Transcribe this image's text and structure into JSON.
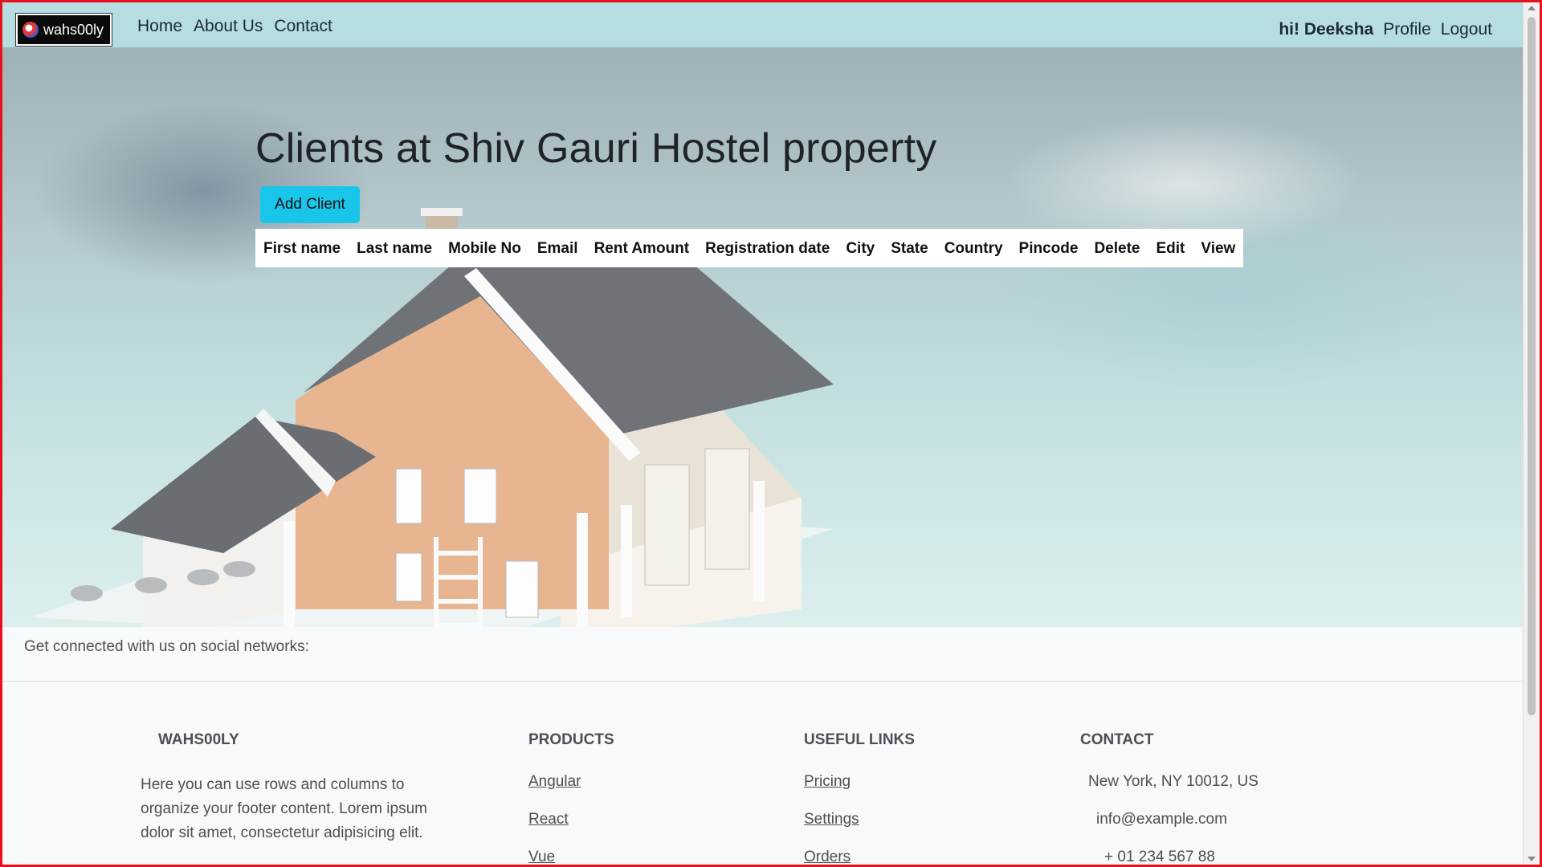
{
  "navbar": {
    "brand": "wahs00ly",
    "links": [
      "Home",
      "About Us",
      "Contact"
    ],
    "greeting": "hi! Deeksha",
    "profile": "Profile",
    "logout": "Logout"
  },
  "main": {
    "title": "Clients at Shiv Gauri Hostel property",
    "add_button": "Add Client",
    "table_headers": [
      "First name",
      "Last name",
      "Mobile No",
      "Email",
      "Rent Amount",
      "Registration date",
      "City",
      "State",
      "Country",
      "Pincode",
      "Delete",
      "Edit",
      "View"
    ]
  },
  "footer": {
    "social_text": "Get connected with us on social networks:",
    "company_heading": "WAHS00LY",
    "company_text": "Here you can use rows and columns to organize your footer content. Lorem ipsum dolor sit amet, consectetur adipisicing elit.",
    "products_heading": "PRODUCTS",
    "products": [
      "Angular",
      "React",
      "Vue"
    ],
    "useful_heading": "USEFUL LINKS",
    "useful_links": [
      "Pricing",
      "Settings",
      "Orders"
    ],
    "contact_heading": "CONTACT",
    "contact_lines": [
      "New York, NY 10012, US",
      "info@example.com",
      "+ 01 234 567 88"
    ]
  },
  "colors": {
    "navbar_bg": "#b6dee0",
    "button_bg": "#19c5e8",
    "frame_border": "#e8101c"
  }
}
